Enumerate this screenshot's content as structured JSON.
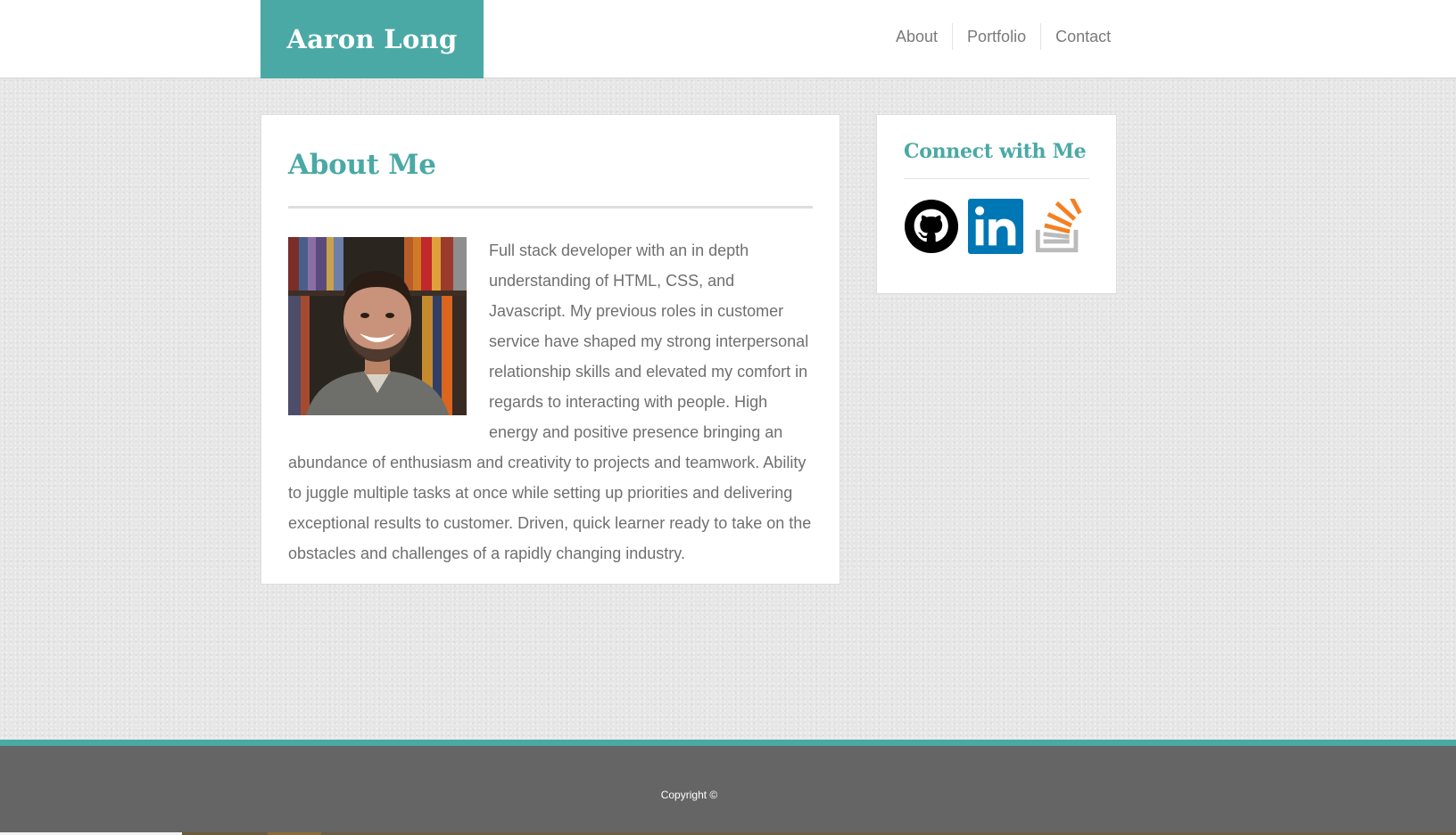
{
  "header": {
    "brand": "Aaron Long",
    "nav": [
      {
        "label": "About"
      },
      {
        "label": "Portfolio"
      },
      {
        "label": "Contact"
      }
    ]
  },
  "about": {
    "title": "About Me",
    "paragraph": "Full stack developer with an in depth understanding of HTML, CSS, and Javascript. My previous roles in customer service have shaped my strong interpersonal relationship skills and elevated my comfort in regards to interacting with people. High energy and positive presence bringing an abundance of enthusiasm and creativity to projects and teamwork. Ability to juggle multiple tasks at once while setting up priorities and delivering exceptional results to customer. Driven, quick learner ready to take on the obstacles and challenges of a rapidly changing industry."
  },
  "connect": {
    "title": "Connect with Me",
    "links": [
      {
        "icon": "github-icon"
      },
      {
        "icon": "linkedin-icon"
      },
      {
        "icon": "stackoverflow-icon"
      }
    ]
  },
  "footer": {
    "copyright": "Copyright ©"
  },
  "colors": {
    "accent": "#4aa9a5",
    "footer_bg": "#656565",
    "text": "#6f6f6f",
    "linkedin": "#0077b5",
    "stackoverflow_orange": "#f48024",
    "stackoverflow_gray": "#bcbbbb"
  }
}
